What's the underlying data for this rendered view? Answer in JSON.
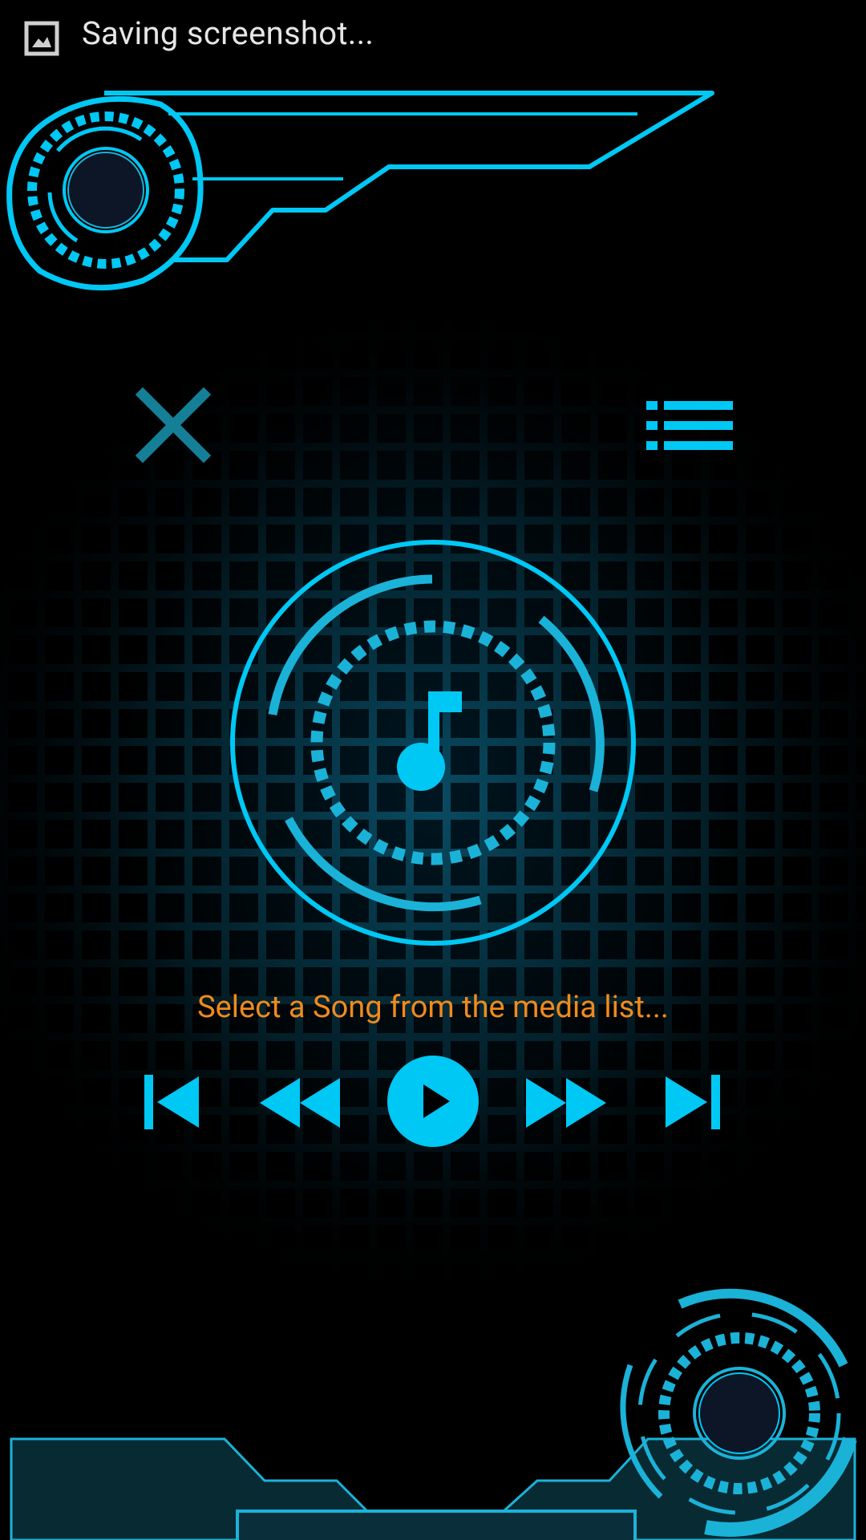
{
  "status_bar": {
    "icon": "screenshot-image-icon",
    "text": "Saving screenshot..."
  },
  "colors": {
    "accent": "#00c8f5",
    "accent_dim": "#1bb2d8",
    "prompt": "#f08a1c",
    "close": "#157f98",
    "panel": "#082a33"
  },
  "header": {
    "close_icon": "close-x-icon",
    "list_icon": "media-list-icon"
  },
  "player": {
    "center_icon": "music-note-icon",
    "prompt": "Select a Song from the media list..."
  },
  "controls": [
    {
      "name": "skip-previous-button",
      "icon": "skip-previous-icon"
    },
    {
      "name": "rewind-button",
      "icon": "rewind-icon"
    },
    {
      "name": "play-button",
      "icon": "play-icon"
    },
    {
      "name": "fast-forward-button",
      "icon": "fast-forward-icon"
    },
    {
      "name": "skip-next-button",
      "icon": "skip-next-icon"
    }
  ]
}
